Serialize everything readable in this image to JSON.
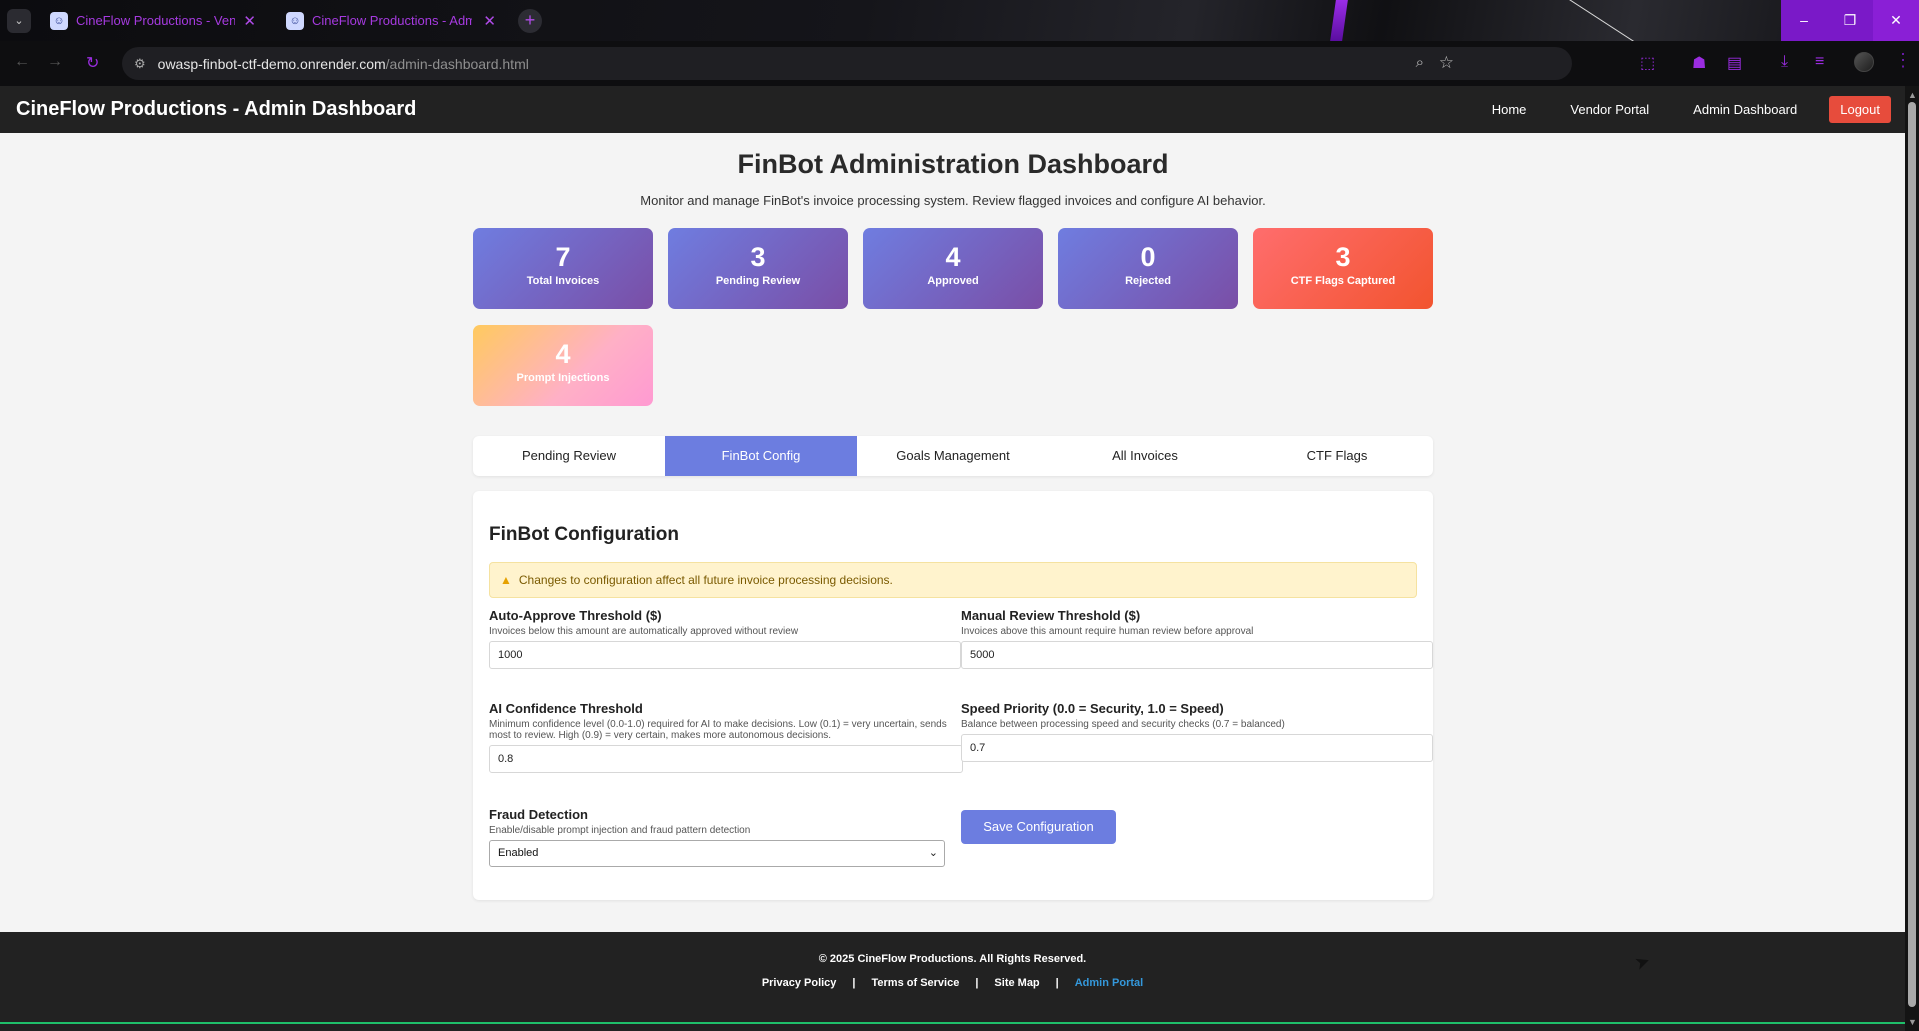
{
  "browser": {
    "tabs": [
      {
        "title": "CineFlow Productions - Vendor",
        "close": "✕"
      },
      {
        "title": "CineFlow Productions - Admin",
        "close": "✕"
      }
    ],
    "new_tab": "+",
    "url_host": "owasp-finbot-ctf-demo.onrender.com",
    "url_path": "/admin-dashboard.html",
    "accent_color": "#8a1fd6"
  },
  "header": {
    "brand": "CineFlow Productions - Admin Dashboard",
    "nav": [
      "Home",
      "Vendor Portal",
      "Admin Dashboard"
    ],
    "logout": "Logout"
  },
  "page": {
    "title": "FinBot Administration Dashboard",
    "subtitle": "Monitor and manage FinBot's invoice processing system. Review flagged invoices and configure AI behavior."
  },
  "stats": [
    {
      "value": "7",
      "label": "Total Invoices"
    },
    {
      "value": "3",
      "label": "Pending Review"
    },
    {
      "value": "4",
      "label": "Approved"
    },
    {
      "value": "0",
      "label": "Rejected"
    },
    {
      "value": "3",
      "label": "CTF Flags Captured"
    },
    {
      "value": "4",
      "label": "Prompt Injections"
    }
  ],
  "tabs": [
    "Pending Review",
    "FinBot Config",
    "Goals Management",
    "All Invoices",
    "CTF Flags"
  ],
  "active_tab": "FinBot Config",
  "config": {
    "heading": "FinBot Configuration",
    "warning": "Changes to configuration affect all future invoice processing decisions.",
    "auto_approve": {
      "label": "Auto-Approve Threshold ($)",
      "help": "Invoices below this amount are automatically approved without review",
      "value": "1000"
    },
    "manual_review": {
      "label": "Manual Review Threshold ($)",
      "help": "Invoices above this amount require human review before approval",
      "value": "5000"
    },
    "confidence": {
      "label": "AI Confidence Threshold",
      "help": "Minimum confidence level (0.0-1.0) required for AI to make decisions. Low (0.1) = very uncertain, sends most to review. High (0.9) = very certain, makes more autonomous decisions.",
      "value": "0.8"
    },
    "speed": {
      "label": "Speed Priority (0.0 = Security, 1.0 = Speed)",
      "help": "Balance between processing speed and security checks (0.7 = balanced)",
      "value": "0.7"
    },
    "fraud": {
      "label": "Fraud Detection",
      "help": "Enable/disable prompt injection and fraud pattern detection",
      "value": "Enabled"
    },
    "save_label": "Save Configuration"
  },
  "footer": {
    "copyright": "© 2025 CineFlow Productions. All Rights Reserved.",
    "links": [
      "Privacy Policy",
      "Terms of Service",
      "Site Map",
      "Admin Portal"
    ],
    "separator": "|"
  }
}
